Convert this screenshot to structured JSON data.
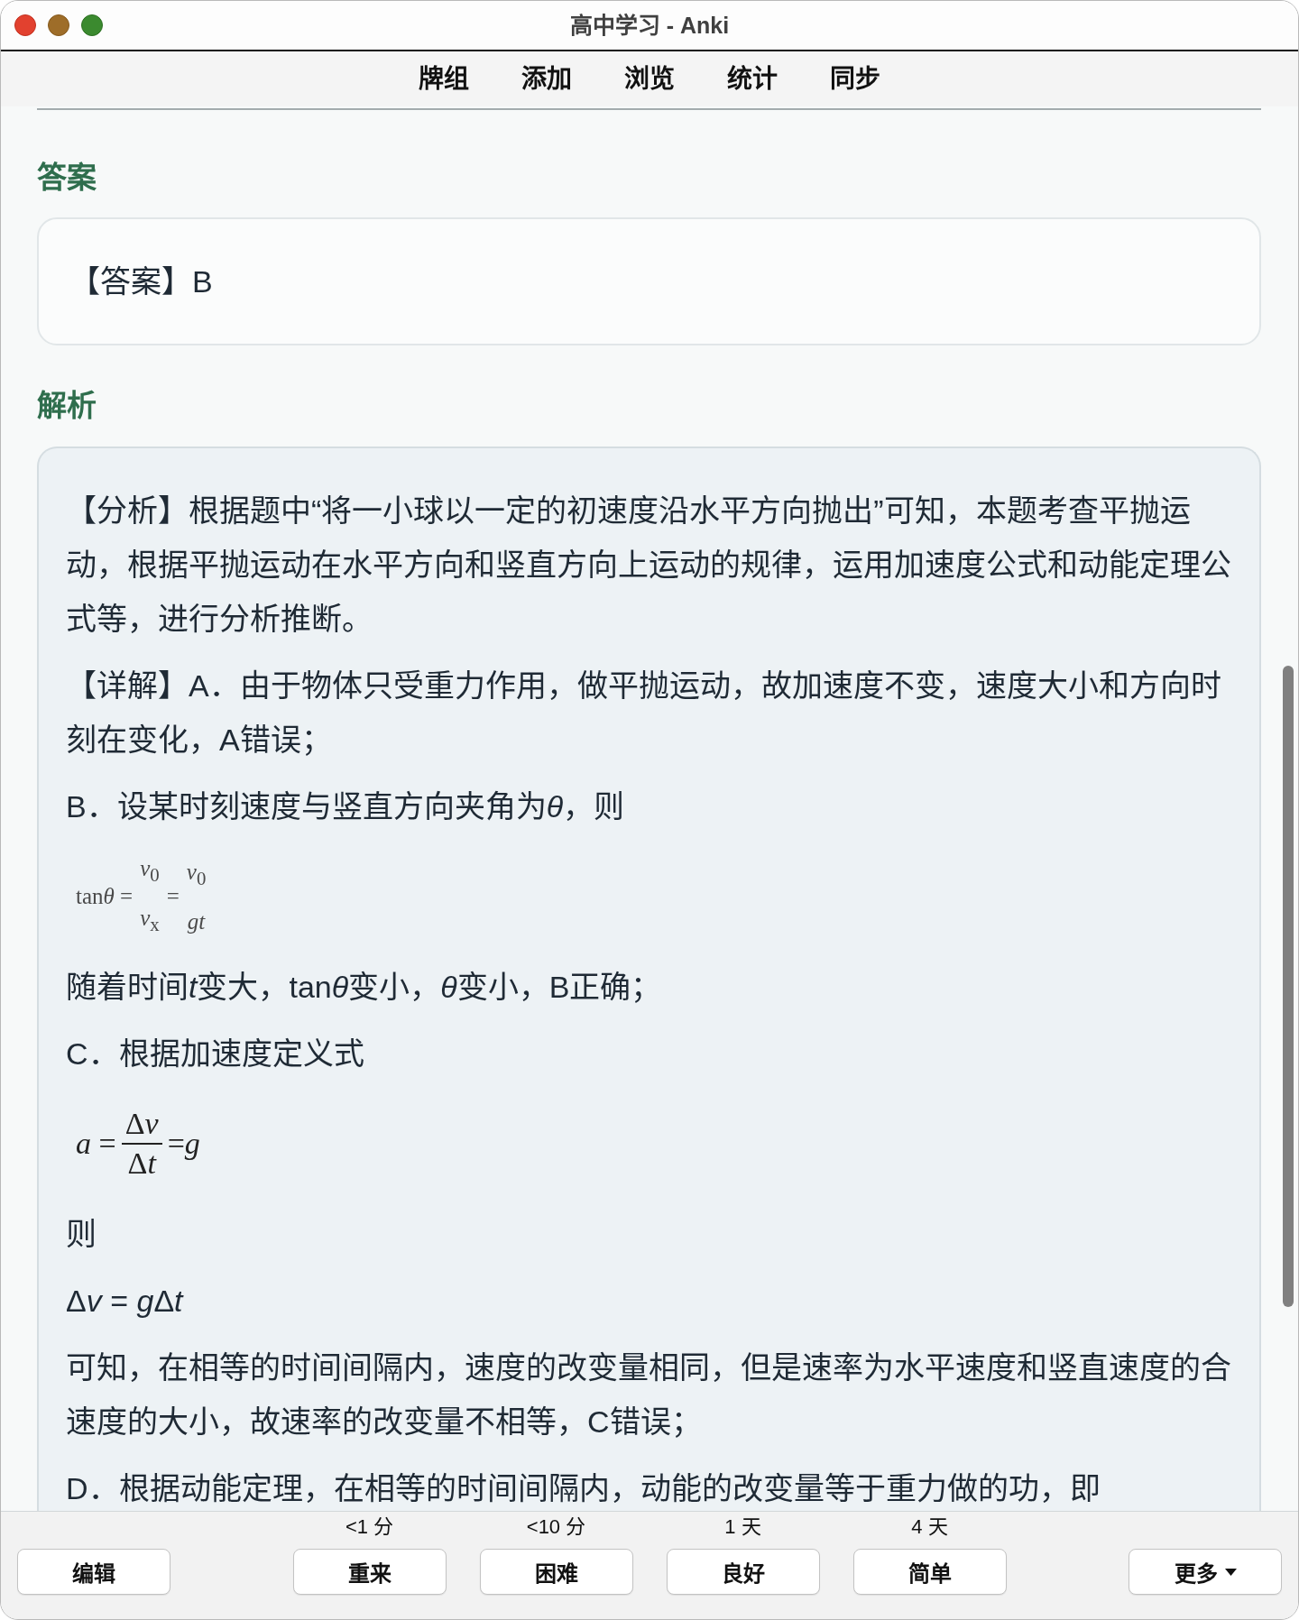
{
  "window": {
    "title": "高中学习 - Anki"
  },
  "toolbar": {
    "links": [
      "牌组",
      "添加",
      "浏览",
      "统计",
      "同步"
    ]
  },
  "answer": {
    "heading": "答案",
    "text": "【答案】B"
  },
  "analysis": {
    "heading": "解析",
    "blocks": [
      {
        "kind": "paragraph",
        "text": "【分析】根据题中“将一小球以一定的初速度沿水平方向抛出”可知，本题考查平抛运动，根据平抛运动在水平方向和竖直方向上运动的规律，运用加速度公式和动能定理公式等，进行分析推断。"
      },
      {
        "kind": "paragraph",
        "text": "【详解】A．由于物体只受重力作用，做平抛运动，故加速度不变，速度大小和方向时刻在变化，A错误；"
      },
      {
        "kind": "paragraph",
        "runs": [
          {
            "text": "B．设某时刻速度与竖直方向夹角为",
            "italic": false
          },
          {
            "text": "θ",
            "italic": true
          },
          {
            "text": "，则",
            "italic": false
          }
        ]
      },
      {
        "kind": "formula",
        "terms": [
          {
            "kind": "text",
            "runs": [
              {
                "text": "tan",
                "italic": false
              },
              {
                "text": "θ",
                "italic": true
              },
              {
                "text": " =",
                "italic": false
              }
            ]
          },
          {
            "kind": "fraction",
            "bar": false,
            "numerator": [
              {
                "text": "v",
                "italic": true
              },
              {
                "text": "$_{0}$",
                "italic": false
              }
            ],
            "denominator": [
              {
                "text": "v",
                "italic": true
              },
              {
                "text": "$_{x}$",
                "italic": false
              }
            ]
          },
          {
            "kind": "text",
            "runs": [
              {
                "text": "=",
                "italic": false
              }
            ]
          },
          {
            "kind": "fraction",
            "bar": false,
            "numerator": [
              {
                "text": "v",
                "italic": true
              },
              {
                "text": "$_{0}$",
                "italic": false
              }
            ],
            "denominator": [
              {
                "text": "gt",
                "italic": true
              }
            ]
          }
        ]
      },
      {
        "kind": "paragraph",
        "runs": [
          {
            "text": "随着时间",
            "italic": false
          },
          {
            "text": "t",
            "italic": true
          },
          {
            "text": "变大，tan",
            "italic": false
          },
          {
            "text": "θ",
            "italic": true
          },
          {
            "text": "变小，",
            "italic": false
          },
          {
            "text": "θ",
            "italic": true
          },
          {
            "text": "变小，B正确；",
            "italic": false
          }
        ]
      },
      {
        "kind": "paragraph",
        "text": "C．根据加速度定义式"
      },
      {
        "kind": "formula",
        "terms": [
          {
            "kind": "text",
            "runs": [
              {
                "text": "a",
                "italic": true
              },
              {
                "text": " =",
                "italic": false
              }
            ]
          },
          {
            "kind": "fraction",
            "bar": true,
            "numerator": [
              {
                "text": "Δ",
                "italic": false
              },
              {
                "text": "v",
                "italic": true
              }
            ],
            "denominator": [
              {
                "text": "Δ",
                "italic": false
              },
              {
                "text": "t",
                "italic": true
              }
            ]
          },
          {
            "kind": "text",
            "runs": [
              {
                "text": "=",
                "italic": false
              },
              {
                "text": "g",
                "italic": true
              }
            ]
          }
        ]
      },
      {
        "kind": "paragraph",
        "text": "则"
      },
      {
        "kind": "paragraph",
        "runs": [
          {
            "text": "Δ",
            "italic": false
          },
          {
            "text": "v",
            "italic": true
          },
          {
            "text": " = ",
            "italic": false
          },
          {
            "text": "g",
            "italic": true
          },
          {
            "text": "Δ",
            "italic": false
          },
          {
            "text": "t",
            "italic": true
          }
        ]
      },
      {
        "kind": "paragraph",
        "text": "可知，在相等的时间间隔内，速度的改变量相同，但是速率为水平速度和竖直速度的合速度的大小，故速率的改变量不相等，C错误；"
      },
      {
        "kind": "paragraph",
        "text": "D．根据动能定理，在相等的时间间隔内，动能的改变量等于重力做的功，即"
      }
    ]
  },
  "review_bar": {
    "edit_button": "编辑",
    "answer_buttons": [
      {
        "interval": "<1 分",
        "label": "重来"
      },
      {
        "interval": "<10 分",
        "label": "困难"
      },
      {
        "interval": "1 天",
        "label": "良好"
      },
      {
        "interval": "4 天",
        "label": "简单"
      }
    ],
    "more_button": "更多"
  }
}
